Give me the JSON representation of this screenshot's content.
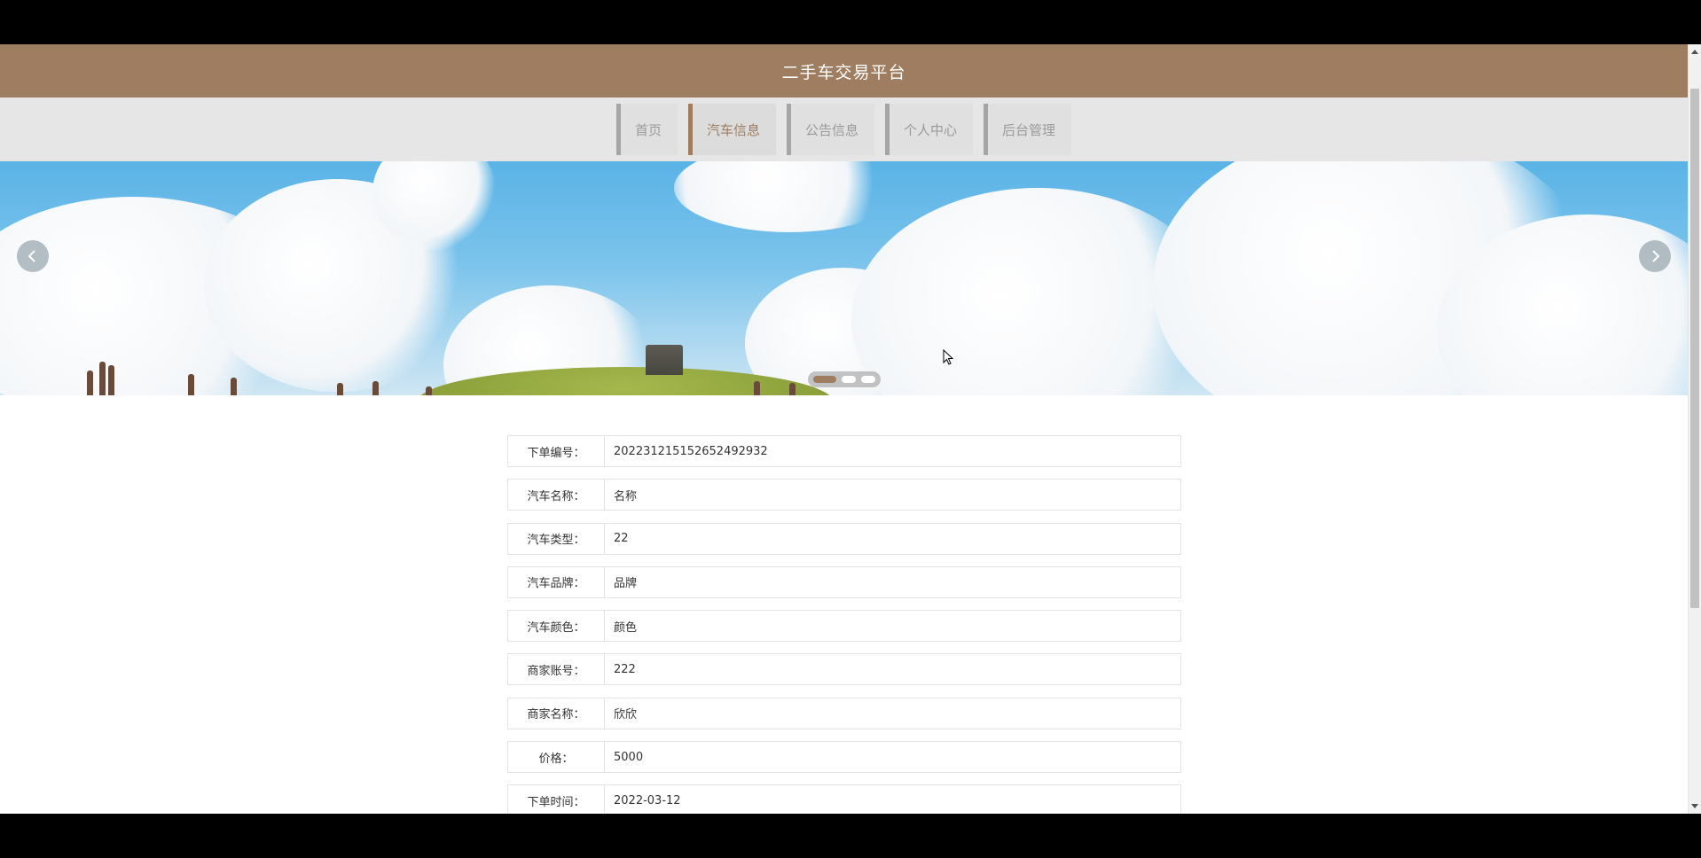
{
  "header": {
    "title": "二手车交易平台",
    "accent_color": "#9e7d61"
  },
  "nav": {
    "items": [
      {
        "label": "首页",
        "active": false
      },
      {
        "label": "汽车信息",
        "active": true
      },
      {
        "label": "公告信息",
        "active": false
      },
      {
        "label": "个人中心",
        "active": false
      },
      {
        "label": "后台管理",
        "active": false
      }
    ]
  },
  "banner": {
    "prev_icon": "chevron-left-icon",
    "next_icon": "chevron-right-icon",
    "slide_count": 3,
    "active_slide": 1
  },
  "order": {
    "fields": [
      {
        "label": "下单编号：",
        "value": "20223121515265249​2932"
      },
      {
        "label": "汽车名称：",
        "value": "名称"
      },
      {
        "label": "汽车类型：",
        "value": "22"
      },
      {
        "label": "汽车品牌：",
        "value": "品牌"
      },
      {
        "label": "汽车颜色：",
        "value": "颜色"
      },
      {
        "label": "商家账号：",
        "value": "222"
      },
      {
        "label": "商家名称：",
        "value": "欣欣"
      },
      {
        "label": "价格：",
        "value": "5000"
      },
      {
        "label": "下单时间：",
        "value": "2022-03-12"
      }
    ]
  }
}
